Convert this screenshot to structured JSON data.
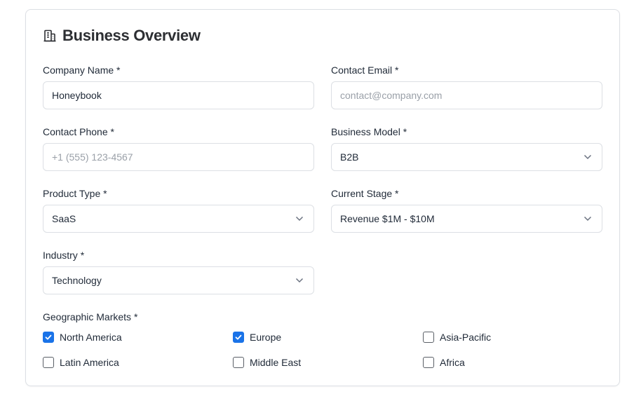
{
  "section": {
    "title": "Business Overview",
    "icon": "building-icon"
  },
  "fields": {
    "company_name": {
      "label": "Company Name *",
      "value": "Honeybook",
      "placeholder": ""
    },
    "contact_email": {
      "label": "Contact Email *",
      "value": "",
      "placeholder": "contact@company.com"
    },
    "contact_phone": {
      "label": "Contact Phone *",
      "value": "",
      "placeholder": "+1 (555) 123-4567"
    },
    "business_model": {
      "label": "Business Model *",
      "value": "B2B"
    },
    "product_type": {
      "label": "Product Type *",
      "value": "SaaS"
    },
    "current_stage": {
      "label": "Current Stage *",
      "value": "Revenue $1M - $10M"
    },
    "industry": {
      "label": "Industry *",
      "value": "Technology"
    }
  },
  "markets": {
    "label": "Geographic Markets *",
    "options": [
      {
        "label": "North America",
        "checked": true
      },
      {
        "label": "Europe",
        "checked": true
      },
      {
        "label": "Asia-Pacific",
        "checked": false
      },
      {
        "label": "Latin America",
        "checked": false
      },
      {
        "label": "Middle East",
        "checked": false
      },
      {
        "label": "Africa",
        "checked": false
      }
    ]
  },
  "colors": {
    "accent": "#1a73e8",
    "border": "#dcdfe4",
    "placeholder": "#9aa0a8"
  }
}
